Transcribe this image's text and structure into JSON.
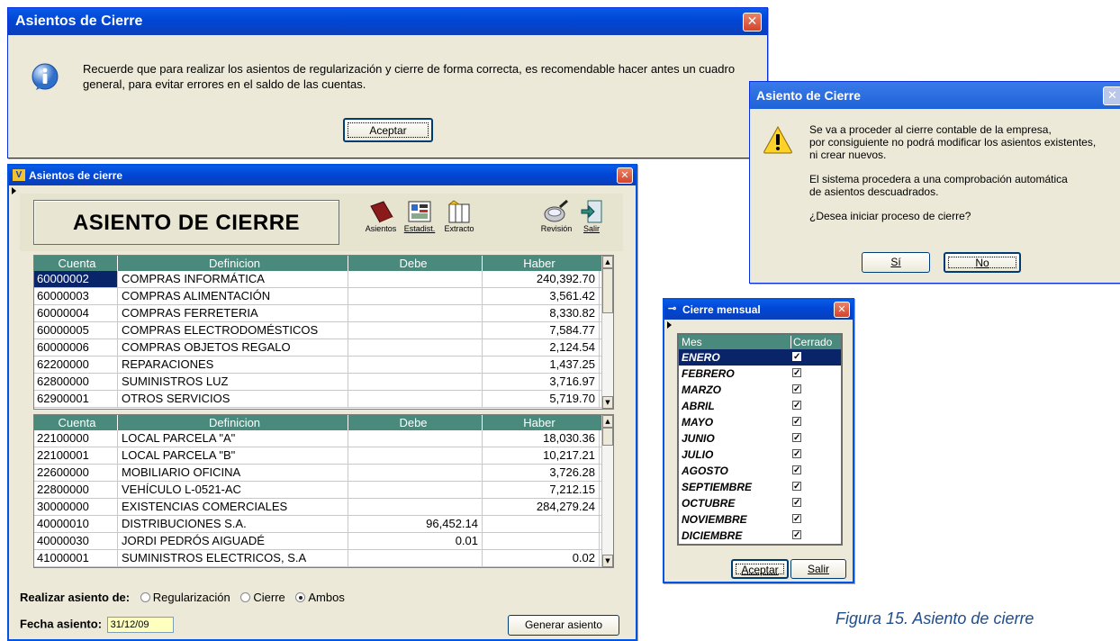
{
  "dialog_info": {
    "title": "Asientos de Cierre",
    "message": "Recuerde que para realizar los asientos de regularización y cierre de forma correcta, es recomendable hacer antes un cuadro general, para evitar errores en el saldo de las cuentas.",
    "ok_label": "Aceptar"
  },
  "dialog_confirm": {
    "title": "Asiento de Cierre",
    "line1": "Se va a proceder al cierre contable de la empresa,",
    "line2": "por consiguiente no podrá modificar los asientos existentes,",
    "line3": "ni crear nuevos.",
    "line4": "El sistema procedera a una comprobación automática",
    "line5": "de asientos descuadrados.",
    "question": "¿Desea iniciar proceso de cierre?",
    "yes_label": "Sí",
    "no_label": "No"
  },
  "main": {
    "title": "Asientos de cierre",
    "banner": "ASIENTO DE CIERRE",
    "toolbar": {
      "asientos": "Asientos",
      "estadist": "Estadist.",
      "extracto": "Extracto",
      "revision": "Revisión",
      "salir": "Salir"
    },
    "columns": {
      "cuenta": "Cuenta",
      "definicion": "Definicion",
      "debe": "Debe",
      "haber": "Haber"
    },
    "grid1": [
      {
        "cuenta": "60000002",
        "definicion": "COMPRAS INFORMÁTICA",
        "debe": "",
        "haber": "240,392.70"
      },
      {
        "cuenta": "60000003",
        "definicion": "COMPRAS ALIMENTACIÓN",
        "debe": "",
        "haber": "3,561.42"
      },
      {
        "cuenta": "60000004",
        "definicion": "COMPRAS FERRETERIA",
        "debe": "",
        "haber": "8,330.82"
      },
      {
        "cuenta": "60000005",
        "definicion": "COMPRAS ELECTRODOMÉSTICOS",
        "debe": "",
        "haber": "7,584.77"
      },
      {
        "cuenta": "60000006",
        "definicion": "COMPRAS OBJETOS REGALO",
        "debe": "",
        "haber": "2,124.54"
      },
      {
        "cuenta": "62200000",
        "definicion": "REPARACIONES",
        "debe": "",
        "haber": "1,437.25"
      },
      {
        "cuenta": "62800000",
        "definicion": "SUMINISTROS LUZ",
        "debe": "",
        "haber": "3,716.97"
      },
      {
        "cuenta": "62900001",
        "definicion": "OTROS SERVICIOS",
        "debe": "",
        "haber": "5,719.70"
      }
    ],
    "grid2": [
      {
        "cuenta": "22100000",
        "definicion": "LOCAL PARCELA \"A\"",
        "debe": "",
        "haber": "18,030.36"
      },
      {
        "cuenta": "22100001",
        "definicion": "LOCAL PARCELA \"B\"",
        "debe": "",
        "haber": "10,217.21"
      },
      {
        "cuenta": "22600000",
        "definicion": "MOBILIARIO OFICINA",
        "debe": "",
        "haber": "3,726.28"
      },
      {
        "cuenta": "22800000",
        "definicion": "VEHÍCULO L-0521-AC",
        "debe": "",
        "haber": "7,212.15"
      },
      {
        "cuenta": "30000000",
        "definicion": "EXISTENCIAS COMERCIALES",
        "debe": "",
        "haber": "284,279.24"
      },
      {
        "cuenta": "40000010",
        "definicion": "DISTRIBUCIONES S.A.",
        "debe": "96,452.14",
        "haber": ""
      },
      {
        "cuenta": "40000030",
        "definicion": "JORDI PEDRÓS AIGUADÉ",
        "debe": "0.01",
        "haber": ""
      },
      {
        "cuenta": "41000001",
        "definicion": "SUMINISTROS ELECTRICOS, S.A",
        "debe": "",
        "haber": "0.02"
      }
    ],
    "realizar_label": "Realizar asiento de:",
    "options": [
      "Regularización",
      "Cierre",
      "Ambos"
    ],
    "selected_option": "Ambos",
    "fecha_label": "Fecha asiento:",
    "fecha_value": "31/12/09",
    "generar_label": "Generar asiento"
  },
  "monthly": {
    "title": "Cierre mensual",
    "col_mes": "Mes",
    "col_cerrado": "Cerrado",
    "months": [
      {
        "name": "ENERO",
        "closed": true
      },
      {
        "name": "FEBRERO",
        "closed": true
      },
      {
        "name": "MARZO",
        "closed": true
      },
      {
        "name": "ABRIL",
        "closed": true
      },
      {
        "name": "MAYO",
        "closed": true
      },
      {
        "name": "JUNIO",
        "closed": true
      },
      {
        "name": "JULIO",
        "closed": true
      },
      {
        "name": "AGOSTO",
        "closed": true
      },
      {
        "name": "SEPTIEMBRE",
        "closed": true
      },
      {
        "name": "OCTUBRE",
        "closed": true
      },
      {
        "name": "NOVIEMBRE",
        "closed": true
      },
      {
        "name": "DICIEMBRE",
        "closed": true
      }
    ],
    "ok_label": "Aceptar",
    "exit_label": "Salir"
  },
  "caption": "Figura 15. Asiento de cierre",
  "colors": {
    "xp_title": "#0046d5",
    "grid_header": "#4a8a7c",
    "selection": "#0a246a",
    "date_bg": "#ffffc0"
  }
}
